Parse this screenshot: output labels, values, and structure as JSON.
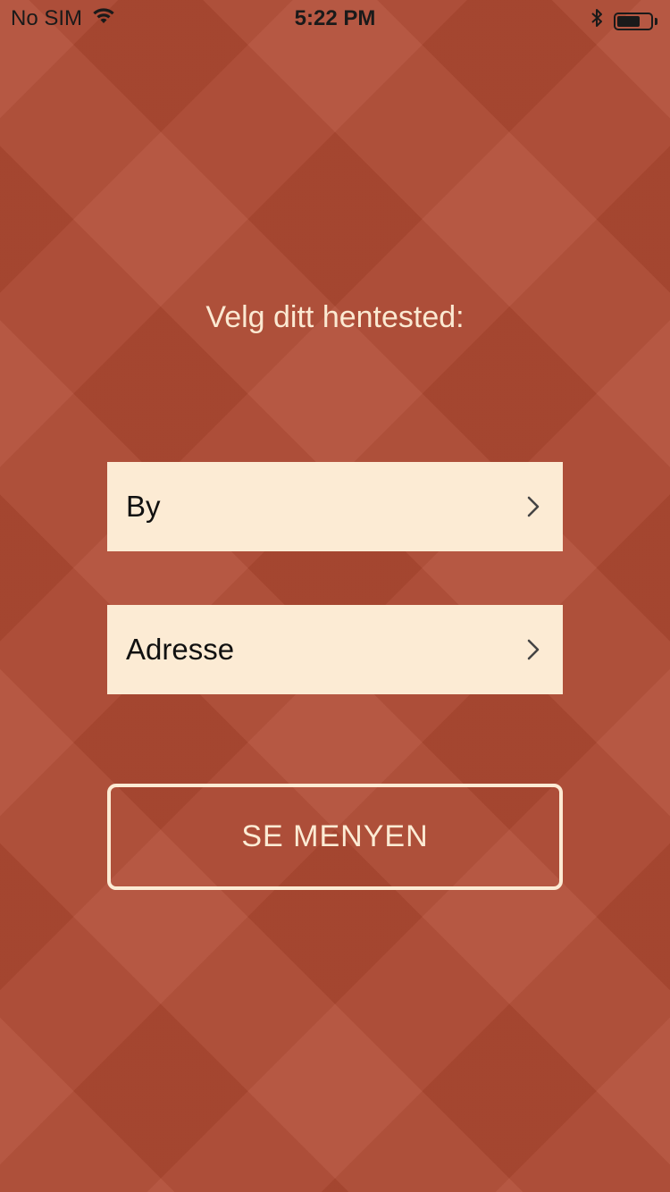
{
  "status_bar": {
    "carrier": "No SIM",
    "time": "5:22 PM",
    "battery_level": 0.7,
    "icons": [
      "wifi-icon",
      "bluetooth-icon",
      "battery-icon"
    ]
  },
  "colors": {
    "background": "#b04a33",
    "field_bg": "#fcebd4",
    "text_light": "#fbe9d2",
    "text_dark": "#111111"
  },
  "main": {
    "prompt": "Velg ditt hentested:",
    "fields": [
      {
        "label": "By",
        "icon": "chevron-right-icon"
      },
      {
        "label": "Adresse",
        "icon": "chevron-right-icon"
      }
    ],
    "cta_label": "SE MENYEN"
  }
}
